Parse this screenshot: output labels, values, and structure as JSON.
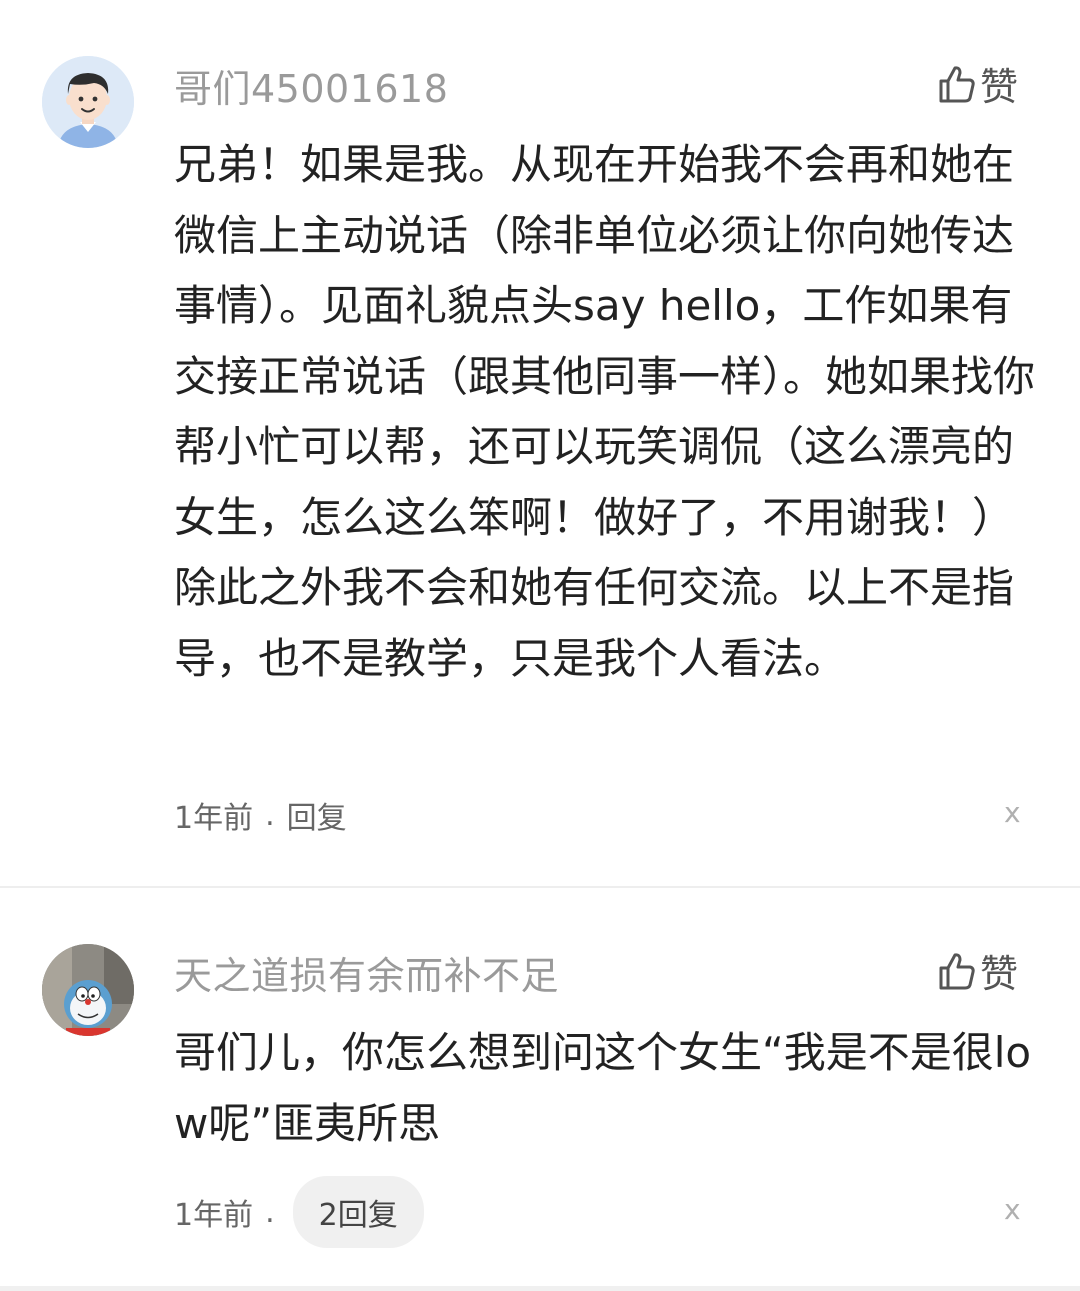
{
  "comments": [
    {
      "username": "哥们45001618",
      "like_label": "赞",
      "text": "兄弟！如果是我。从现在开始我不会再和她在微信上主动说话（除非单位必须让你向她传达事情）。见面礼貌点头say hello，工作如果有交接正常说话（跟其他同事一样）。她如果找你帮小忙可以帮，还可以玩笑调侃（这么漂亮的女生，怎么这么笨啊！做好了，不用谢我！）除此之外我不会和她有任何交流。以上不是指导，也不是教学，只是我个人看法。",
      "time": "1年前",
      "separator": ".",
      "reply_label": "回复",
      "close_label": "x"
    },
    {
      "username": "天之道损有余而补不足",
      "like_label": "赞",
      "text": "哥们儿，你怎么想到问这个女生“我是不是很low呢”匪夷所思",
      "time": "1年前",
      "separator": ".",
      "reply_label": "2回复",
      "close_label": "x"
    }
  ],
  "icons": {
    "like": "thumbs-up-outline-icon",
    "avatar1": "cartoon-man-avatar",
    "avatar2": "doraemon-avatar"
  }
}
